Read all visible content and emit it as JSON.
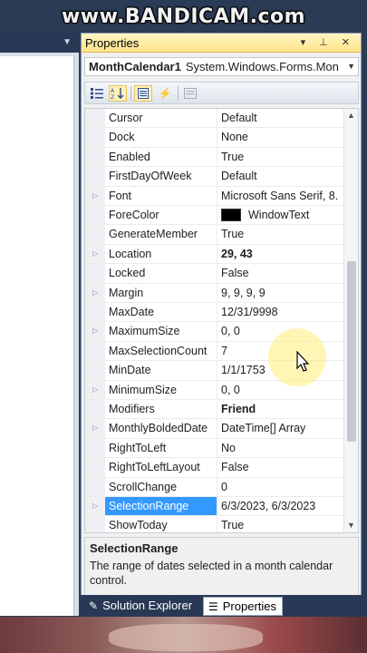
{
  "watermark": "www.BANDICAM.com",
  "panel": {
    "title": "Properties",
    "controls": "▾ ⊥ ✕"
  },
  "object_selector": {
    "name": "MonthCalendar1",
    "type": "System.Windows.Forms.Mon"
  },
  "toolbar": {
    "buttons": [
      "categorized-icon",
      "alphabetical-icon",
      "properties-icon",
      "events-icon",
      "property-pages-icon"
    ],
    "active_button": "alphabetical-icon"
  },
  "properties": [
    {
      "name": "Cursor",
      "value": "Default",
      "expandable": false
    },
    {
      "name": "Dock",
      "value": "None",
      "expandable": false
    },
    {
      "name": "Enabled",
      "value": "True",
      "expandable": false
    },
    {
      "name": "FirstDayOfWeek",
      "value": "Default",
      "expandable": false
    },
    {
      "name": "Font",
      "value": "Microsoft Sans Serif, 8.",
      "expandable": true
    },
    {
      "name": "ForeColor",
      "value": "WindowText",
      "expandable": false,
      "swatch": "#000000"
    },
    {
      "name": "GenerateMember",
      "value": "True",
      "expandable": false
    },
    {
      "name": "Location",
      "value": "29, 43",
      "expandable": true,
      "bold": true
    },
    {
      "name": "Locked",
      "value": "False",
      "expandable": false
    },
    {
      "name": "Margin",
      "value": "9, 9, 9, 9",
      "expandable": true
    },
    {
      "name": "MaxDate",
      "value": "12/31/9998",
      "expandable": false
    },
    {
      "name": "MaximumSize",
      "value": "0, 0",
      "expandable": true
    },
    {
      "name": "MaxSelectionCount",
      "value": "7",
      "expandable": false
    },
    {
      "name": "MinDate",
      "value": "1/1/1753",
      "expandable": false
    },
    {
      "name": "MinimumSize",
      "value": "0, 0",
      "expandable": true
    },
    {
      "name": "Modifiers",
      "value": "Friend",
      "expandable": false,
      "bold": true
    },
    {
      "name": "MonthlyBoldedDate",
      "value": "DateTime[] Array",
      "expandable": true
    },
    {
      "name": "RightToLeft",
      "value": "No",
      "expandable": false
    },
    {
      "name": "RightToLeftLayout",
      "value": "False",
      "expandable": false
    },
    {
      "name": "ScrollChange",
      "value": "0",
      "expandable": false
    },
    {
      "name": "SelectionRange",
      "value": "6/3/2023, 6/3/2023",
      "expandable": true,
      "selected": true
    },
    {
      "name": "ShowToday",
      "value": "True",
      "expandable": false
    }
  ],
  "description": {
    "title": "SelectionRange",
    "text": "The range of dates selected in a month calendar control."
  },
  "tabs": [
    {
      "label": "Solution Explorer",
      "icon": "solution-explorer-icon",
      "active": false
    },
    {
      "label": "Properties",
      "icon": "properties-tab-icon",
      "active": true
    }
  ],
  "scroll": {
    "position_fraction": 0.35,
    "visible_fraction": 0.45
  },
  "colors": {
    "selection": "#3399ff",
    "panel_title": "#ffe48a",
    "tab_strip": "#293955"
  }
}
